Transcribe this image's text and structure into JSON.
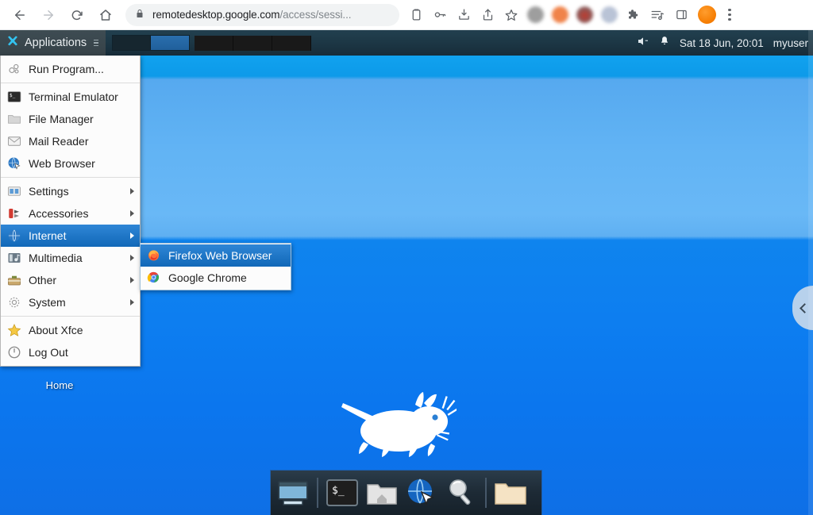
{
  "browser": {
    "back_icon": "back-arrow-icon",
    "forward_icon": "forward-arrow-icon",
    "reload_icon": "reload-icon",
    "home_icon": "home-icon",
    "url_domain": "remotedesktop.google.com",
    "url_path": "/access/sessi...",
    "url_full": "remotedesktop.google.com/access/sessi...",
    "lock_icon": "lock-icon",
    "toolbar_icons": [
      "clipboard-icon",
      "key-icon",
      "download-icon",
      "share-icon",
      "bookmark-star-icon"
    ],
    "extension_icons": [
      "extension-blurred-gray-icon",
      "extension-blurred-orange-icon",
      "extension-blurred-red-icon",
      "extension-blurred-blue-icon"
    ],
    "puzzle_icon": "puzzle-extensions-icon",
    "playlist_icon": "playlist-icon",
    "sidepanel_icon": "side-panel-icon",
    "avatar_icon": "profile-avatar-icon",
    "menu_icon": "kebab-menu-icon"
  },
  "panel": {
    "applications_label": "Applications",
    "applications_icon": "xfce-mouse-icon",
    "handle_icon": "panel-handle-icon",
    "workspace_count": 4,
    "active_workspace": 1,
    "volume_icon": "speaker-muted-icon",
    "notification_icon": "bell-icon",
    "clock": "Sat 18 Jun, 20:01",
    "user": "myuser"
  },
  "app_menu": {
    "items": [
      {
        "label": "Run Program...",
        "icon": "run-program-icon",
        "arrow": false
      },
      {
        "label": "Terminal Emulator",
        "icon": "terminal-icon",
        "arrow": false
      },
      {
        "label": "File Manager",
        "icon": "file-manager-icon",
        "arrow": false
      },
      {
        "label": "Mail Reader",
        "icon": "mail-reader-icon",
        "arrow": false
      },
      {
        "label": "Web Browser",
        "icon": "web-browser-icon",
        "arrow": false
      },
      {
        "label": "Settings",
        "icon": "settings-icon",
        "arrow": true
      },
      {
        "label": "Accessories",
        "icon": "accessories-icon",
        "arrow": true
      },
      {
        "label": "Internet",
        "icon": "internet-globe-icon",
        "arrow": true
      },
      {
        "label": "Multimedia",
        "icon": "multimedia-icon",
        "arrow": true
      },
      {
        "label": "Other",
        "icon": "other-toolbox-icon",
        "arrow": true
      },
      {
        "label": "System",
        "icon": "system-gear-icon",
        "arrow": true
      },
      {
        "label": "About Xfce",
        "icon": "about-xfce-star-icon",
        "arrow": false
      },
      {
        "label": "Log Out",
        "icon": "log-out-power-icon",
        "arrow": false
      }
    ],
    "selected_index": 7
  },
  "submenu": {
    "title": "Internet",
    "items": [
      {
        "label": "Firefox Web Browser",
        "icon": "firefox-icon",
        "selected": true
      },
      {
        "label": "Google Chrome",
        "icon": "chrome-icon",
        "selected": false
      }
    ]
  },
  "desktop": {
    "home_icon_label": "Home",
    "logo_icon": "xfce-mouse-logo",
    "background_colors": [
      "#0a9ceb",
      "#61b3f4",
      "#0d7ef0",
      "#0e6fe6"
    ]
  },
  "dock": {
    "items": [
      {
        "icon": "show-desktop-icon"
      },
      {
        "icon": "separator"
      },
      {
        "icon": "terminal-icon"
      },
      {
        "icon": "home-folder-icon"
      },
      {
        "icon": "web-browser-globe-icon"
      },
      {
        "icon": "search-magnifier-icon"
      },
      {
        "icon": "separator"
      },
      {
        "icon": "file-folder-icon"
      }
    ]
  },
  "overlay": {
    "pulltab_icon": "chevron-left-icon"
  },
  "colors": {
    "menu_highlight": "#1168b8",
    "panel_bg": "#1c3644",
    "desktop_blue": "#0d7ef0",
    "accent_orange": "#f57c00"
  }
}
